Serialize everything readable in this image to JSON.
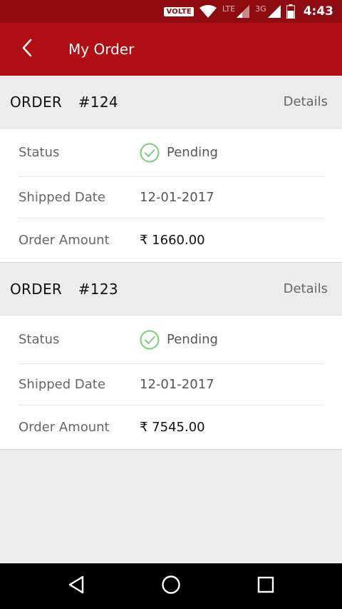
{
  "status_bar": {
    "volte": "VOLTE",
    "lte": "LTE",
    "network_3g": "3G",
    "time": "4:43"
  },
  "app_bar": {
    "title": "My Order"
  },
  "orders": [
    {
      "label": "ORDER",
      "number": "#124",
      "details": "Details",
      "status_label": "Status",
      "status_value": "Pending",
      "shipped_label": "Shipped Date",
      "shipped_value": "12-01-2017",
      "amount_label": "Order Amount",
      "amount_value": "₹ 1660.00"
    },
    {
      "label": "ORDER",
      "number": "#123",
      "details": "Details",
      "status_label": "Status",
      "status_value": "Pending",
      "shipped_label": "Shipped Date",
      "shipped_value": "12-01-2017",
      "amount_label": "Order Amount",
      "amount_value": "₹ 7545.00"
    }
  ],
  "colors": {
    "status_bar": "#8e0b10",
    "app_bar": "#b10e14",
    "check_green": "#7dcc7d"
  }
}
